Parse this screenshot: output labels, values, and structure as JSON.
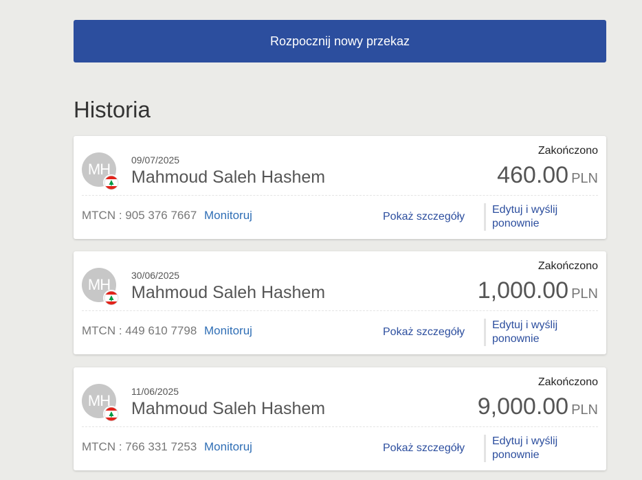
{
  "actions": {
    "new_transfer_label": "Rozpocznij nowy przekaz"
  },
  "history": {
    "title": "Historia",
    "transactions": [
      {
        "initials": "MH",
        "date": "09/07/2025",
        "name": "Mahmoud Saleh Hashem",
        "status": "Zakończono",
        "amount": "460.00",
        "currency": "PLN",
        "mtcn_label": "MTCN :",
        "mtcn": "905 376 7667",
        "monitor_label": "Monitoruj",
        "details_label": "Pokaż szczegóły",
        "resend_label": "Edytuj i wyślij ponownie",
        "flag_icon": "lebanon-flag-icon"
      },
      {
        "initials": "MH",
        "date": "30/06/2025",
        "name": "Mahmoud Saleh Hashem",
        "status": "Zakończono",
        "amount": "1,000.00",
        "currency": "PLN",
        "mtcn_label": "MTCN :",
        "mtcn": "449 610 7798",
        "monitor_label": "Monitoruj",
        "details_label": "Pokaż szczegóły",
        "resend_label": "Edytuj i wyślij ponownie",
        "flag_icon": "lebanon-flag-icon"
      },
      {
        "initials": "MH",
        "date": "11/06/2025",
        "name": "Mahmoud Saleh Hashem",
        "status": "Zakończono",
        "amount": "9,000.00",
        "currency": "PLN",
        "mtcn_label": "MTCN :",
        "mtcn": "766 331 7253",
        "monitor_label": "Monitoruj",
        "details_label": "Pokaż szczegóły",
        "resend_label": "Edytuj i wyślij ponownie",
        "flag_icon": "lebanon-flag-icon"
      }
    ]
  },
  "colors": {
    "primary_button": "#2c4e9e",
    "link": "#2f6eb5",
    "background": "#ebebe8"
  }
}
